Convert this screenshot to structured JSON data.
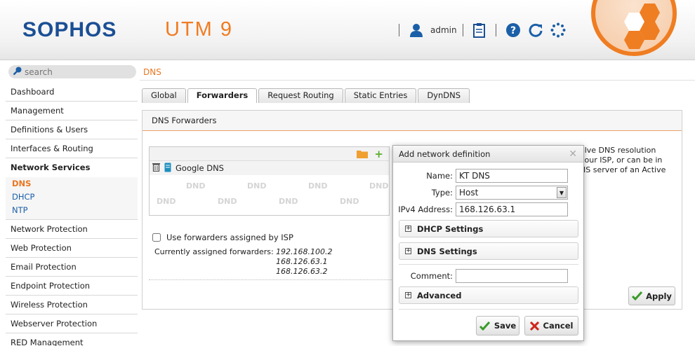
{
  "header": {
    "logo": "SOPHOS",
    "product": "UTM 9",
    "user": "admin",
    "accent": "#f07c22",
    "brand_blue": "#1b4f95"
  },
  "sidebar": {
    "search_placeholder": "search",
    "items": [
      {
        "label": "Dashboard"
      },
      {
        "label": "Management"
      },
      {
        "label": "Definitions & Users"
      },
      {
        "label": "Interfaces & Routing"
      },
      {
        "label": "Network Services"
      },
      {
        "label": "Network Protection"
      },
      {
        "label": "Web Protection"
      },
      {
        "label": "Email Protection"
      },
      {
        "label": "Endpoint Protection"
      },
      {
        "label": "Wireless Protection"
      },
      {
        "label": "Webserver Protection"
      },
      {
        "label": "RED Management"
      }
    ],
    "subitems": [
      {
        "label": "DNS",
        "active": true
      },
      {
        "label": "DHCP"
      },
      {
        "label": "NTP"
      }
    ]
  },
  "main": {
    "page_title": "DNS",
    "tabs": [
      {
        "label": "Global"
      },
      {
        "label": "Forwarders",
        "active": true
      },
      {
        "label": "Request Routing"
      },
      {
        "label": "Static Entries"
      },
      {
        "label": "DynDNS"
      }
    ],
    "panel_title": "DNS Forwarders",
    "forwarders_list": [
      {
        "name": "Google DNS"
      }
    ],
    "watermark": "DND",
    "isp_checkbox_label": "Use forwarders assigned by ISP",
    "assigned_label": "Currently assigned forwarders:",
    "assigned_values": [
      "192.168.100.2",
      "168.126.63.1",
      "168.126.63.2"
    ],
    "help_lines": [
      "olve DNS resolution",
      "your ISP, or can be in",
      "NS server of an Active"
    ],
    "apply_label": "Apply"
  },
  "dialog": {
    "title": "Add network definition",
    "name_label": "Name:",
    "name_value": "KT DNS",
    "type_label": "Type:",
    "type_value": "Host",
    "ipv4_label": "IPv4 Address:",
    "ipv4_value": "168.126.63.1",
    "sections": [
      {
        "label": "DHCP Settings"
      },
      {
        "label": "DNS Settings"
      }
    ],
    "comment_label": "Comment:",
    "comment_value": "",
    "advanced_label": "Advanced",
    "save_label": "Save",
    "cancel_label": "Cancel"
  }
}
